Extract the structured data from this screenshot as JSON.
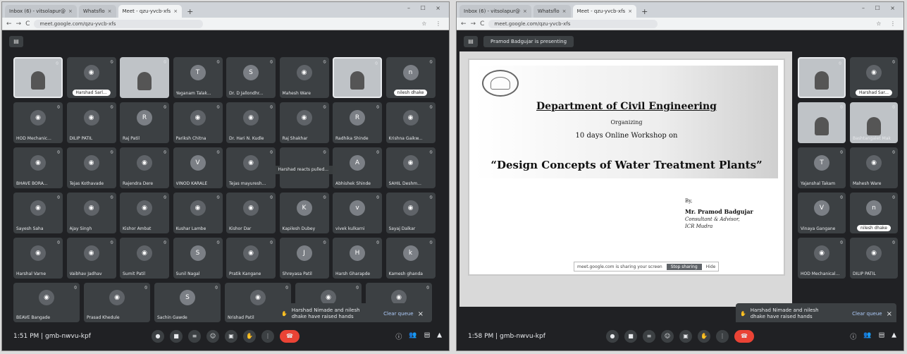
{
  "left": {
    "tabs": [
      "Inbox (6) - vitsolapur@",
      "Whatsflo",
      "Meet - qzu-yvcb-xfs"
    ],
    "url": "meet.google.com/qzu-yvcb-xfs",
    "tiles": [
      {
        "name": "",
        "kind": "video-frame"
      },
      {
        "name": "Harshad Sarl...",
        "kind": "avatar",
        "pill": true
      },
      {
        "name": "",
        "kind": "video"
      },
      {
        "name": "Yeganam Talak...",
        "letter": "T"
      },
      {
        "name": "Dr. D Jallondhr...",
        "letter": "S"
      },
      {
        "name": "Mahesh Ware",
        "kind": "avatar"
      },
      {
        "name": "",
        "kind": "video-frame"
      },
      {
        "name": "nilesh dhake",
        "letter": "n",
        "pill": true
      },
      {
        "name": "HOD Mechanic...",
        "kind": "avatar"
      },
      {
        "name": "DILIP PATIL",
        "kind": "avatar"
      },
      {
        "name": "Raj Patil",
        "letter": "R"
      },
      {
        "name": "Pariksh Chitna",
        "kind": "avatar"
      },
      {
        "name": "Dr. Hari N. Kudle",
        "kind": "avatar"
      },
      {
        "name": "Raj Shakhar",
        "kind": "avatar"
      },
      {
        "name": "Radhika Shinde",
        "letter": "R"
      },
      {
        "name": "Krishna Gaikw...",
        "kind": "avatar"
      },
      {
        "name": "BHAVE BORA...",
        "kind": "avatar"
      },
      {
        "name": "Tejas Kothavade",
        "kind": "avatar"
      },
      {
        "name": "Rajendra Dere",
        "kind": "avatar"
      },
      {
        "name": "VINOD KARALE",
        "letter": "V"
      },
      {
        "name": "Tejas mayuresh...",
        "kind": "avatar"
      },
      {
        "name": "",
        "kind": "hands"
      },
      {
        "name": "Abhishek Shinde",
        "letter": "A"
      },
      {
        "name": "SAHIL Deshm...",
        "kind": "avatar"
      },
      {
        "name": "Sayesh Saha",
        "kind": "avatar"
      },
      {
        "name": "Ajay Singh",
        "kind": "avatar"
      },
      {
        "name": "Kishor Ambat",
        "kind": "avatar"
      },
      {
        "name": "Kushar Lambe",
        "kind": "avatar"
      },
      {
        "name": "Kishor Dar",
        "kind": "avatar"
      },
      {
        "name": "Kapilesh Dubey",
        "letter": "K"
      },
      {
        "name": "vivek kulkarni",
        "letter": "v"
      },
      {
        "name": "Sayaj Dalkar",
        "kind": "avatar"
      },
      {
        "name": "Harshal Varne",
        "kind": "avatar"
      },
      {
        "name": "Vaibhav Jadhav",
        "kind": "avatar"
      },
      {
        "name": "Sumit Patil",
        "kind": "avatar"
      },
      {
        "name": "Sunil Nagal",
        "letter": "S"
      },
      {
        "name": "Pratik Kangane",
        "kind": "avatar"
      },
      {
        "name": "Shreyasa Patil",
        "letter": "J"
      },
      {
        "name": "Harsh Gharapde",
        "letter": "H"
      },
      {
        "name": "Kamesh ghanda",
        "letter": "k"
      }
    ],
    "last_row": [
      {
        "name": "BEAVE Bangade",
        "kind": "avatar"
      },
      {
        "name": "Prasad Khedule",
        "kind": "avatar"
      },
      {
        "name": "Sachin Gawde",
        "letter": "S"
      },
      {
        "name": "Nrishad Patil",
        "kind": "avatar"
      },
      {
        "name": "",
        "kind": "avatar"
      },
      {
        "name": "",
        "kind": "avatar"
      }
    ],
    "hands_label": "Harshad reacts pulled...",
    "toast": {
      "message": "Harshad Nimade and nilesh dhake have raised hands",
      "action": "Clear queue",
      "close": "×"
    },
    "meeting_info": "1:51 PM | gmb-nwvu-kpf"
  },
  "right": {
    "tabs": [
      "Inbox (6) - vitsolapur@",
      "Whatsflo",
      "Meet - qzu-yvcb-xfs"
    ],
    "url": "meet.google.com/qzu-yvcb-xfs",
    "presenting": "Pramod Badgujar is presenting",
    "slide": {
      "department": "Department of Civil Engineering",
      "organizing": "Organizing",
      "workshop": "10 days Online Workshop on",
      "topic": "“Design Concepts of Water Treatment Plants”",
      "by": "By,",
      "presenter": "Mr. Pramod Badgujar",
      "role1": "Consultant & Advisor,",
      "role2": "ICR Mudra"
    },
    "ppt_bar": {
      "text": "meet.google.com is sharing your screen",
      "stop": "Stop sharing",
      "hide": "Hide"
    },
    "side_tiles": [
      {
        "name": "",
        "kind": "video-frame"
      },
      {
        "name": "Harshad Sar...",
        "kind": "avatar",
        "pill": true
      },
      {
        "name": "",
        "kind": "video"
      },
      {
        "name": "Bashtangalet Mak",
        "kind": "video"
      },
      {
        "name": "Yajanshal Takam",
        "letter": "T"
      },
      {
        "name": "Mahesh Ware",
        "kind": "avatar"
      },
      {
        "name": "Vinaya Gangane",
        "letter": "V"
      },
      {
        "name": "nilesh dhake",
        "letter": "n",
        "pill": true
      },
      {
        "name": "HOD Mechanical...",
        "kind": "avatar"
      },
      {
        "name": "DILIP PATIL",
        "kind": "avatar"
      }
    ],
    "toast": {
      "message": "Harshad Nimade and nilesh dhake have raised hands",
      "action": "Clear queue",
      "close": "×"
    },
    "meeting_info": "1:58 PM | gmb-nwvu-kpf"
  }
}
